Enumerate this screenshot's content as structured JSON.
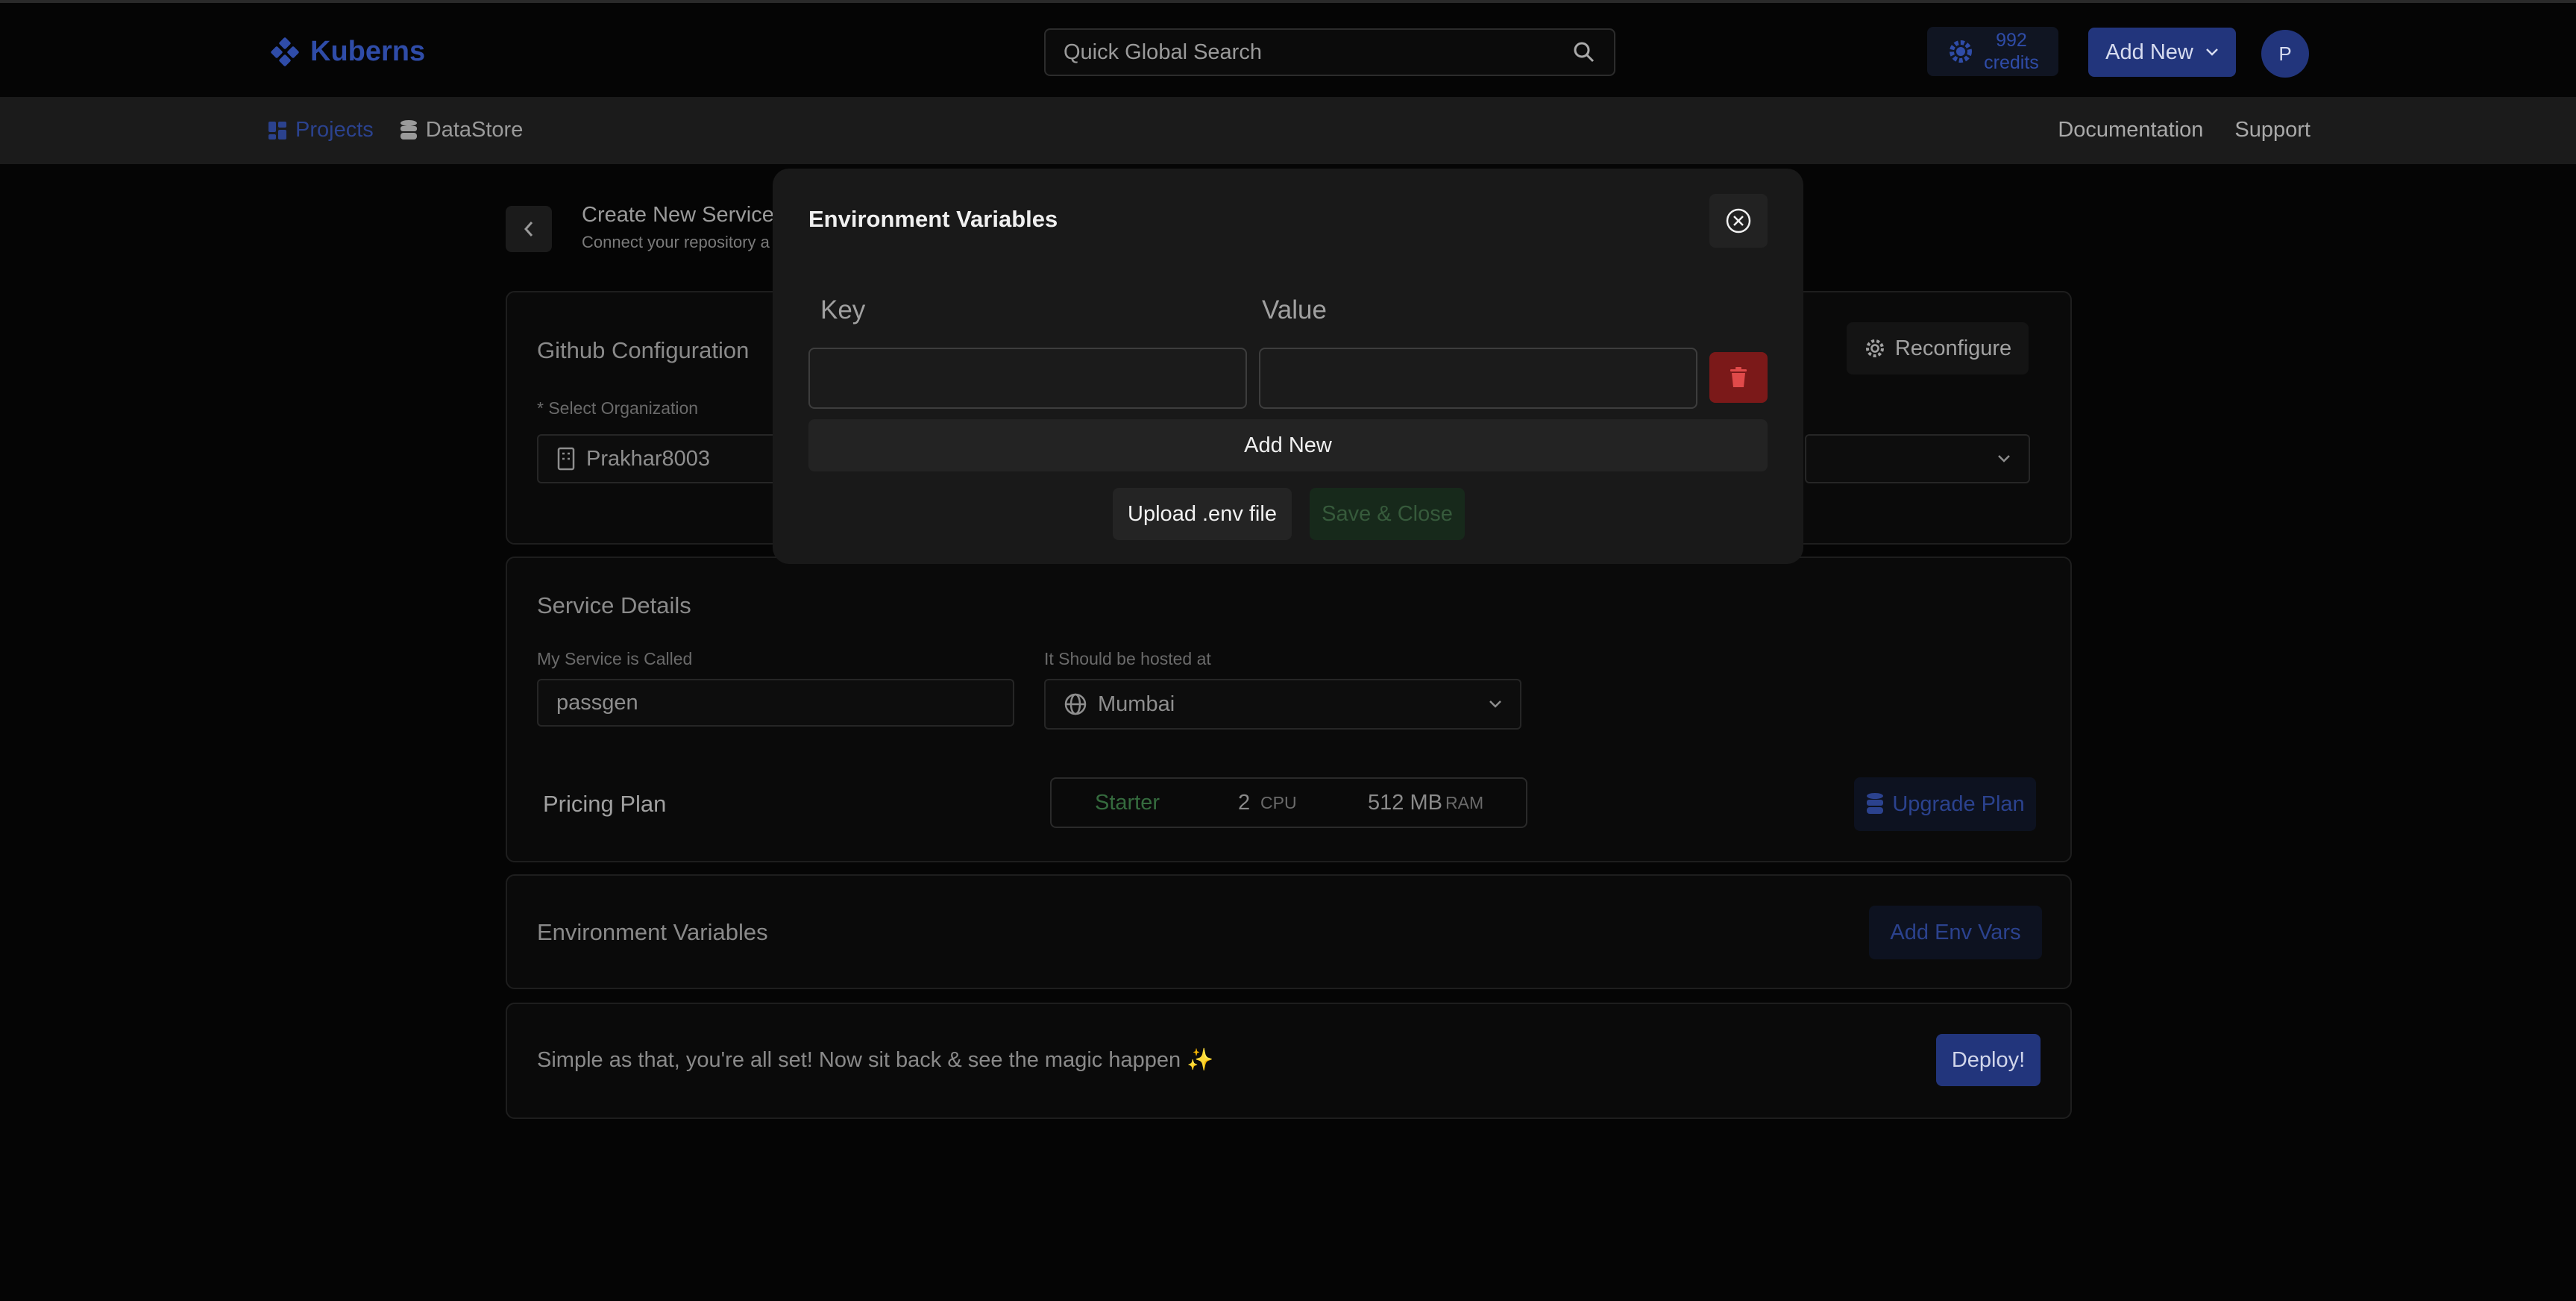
{
  "brand": {
    "name": "Kuberns",
    "color": "#2f4ca8"
  },
  "search": {
    "placeholder": "Quick Global Search"
  },
  "credits": {
    "amount": "992",
    "label": "credits"
  },
  "header": {
    "add_new": "Add New",
    "avatar_initial": "P"
  },
  "nav": {
    "left": [
      {
        "label": "Projects",
        "icon": "grid-icon"
      },
      {
        "label": "DataStore",
        "icon": "database-icon"
      }
    ],
    "right": [
      "Documentation",
      "Support"
    ]
  },
  "page": {
    "title": "Create New Service",
    "subtitle": "Connect your repository a"
  },
  "github": {
    "title": "Github Configuration",
    "org_label": "* Select Organization",
    "org_value": "Prakhar8003",
    "reconfigure": "Reconfigure"
  },
  "service": {
    "title": "Service Details",
    "name_label": "My Service is Called",
    "name_value": "passgen",
    "region_label": "It Should be hosted at",
    "region_value": "Mumbai",
    "pricing_label": "Pricing Plan",
    "plan": {
      "name": "Starter",
      "cpu_value": "2",
      "cpu_unit": "CPU",
      "ram_value": "512 MB",
      "ram_unit": "RAM"
    },
    "upgrade": "Upgrade Plan"
  },
  "env": {
    "title": "Environment Variables",
    "add": "Add Env Vars"
  },
  "deploy": {
    "message": "Simple as that, you're all set! Now sit back & see the magic happen ✨",
    "button": "Deploy!"
  },
  "modal": {
    "title": "Environment Variables",
    "key_header": "Key",
    "value_header": "Value",
    "key_value": "",
    "value_value": "",
    "add_new": "Add New",
    "upload": "Upload .env file",
    "save": "Save & Close"
  },
  "colors": {
    "accent": "#22357c",
    "danger": "#7b1919",
    "success_muted": "#17291b"
  }
}
